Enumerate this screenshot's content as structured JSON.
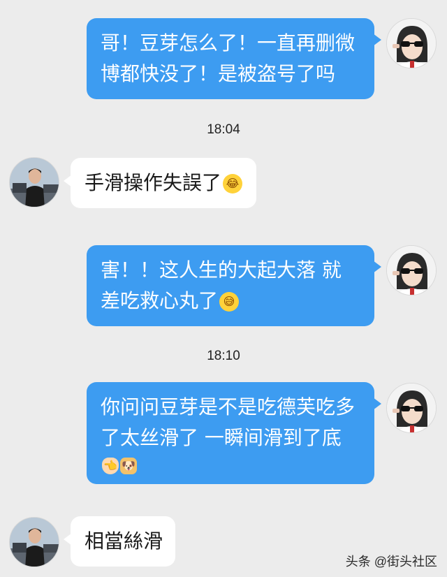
{
  "messages": [
    {
      "side": "me",
      "lines": [
        "哥！豆芽怎么了！一直再删微",
        "博都快没了！是被盗号了吗"
      ]
    },
    {
      "timestamp": "18:04"
    },
    {
      "side": "other",
      "lines": [
        "手滑操作失誤了"
      ],
      "emoji": "laughing-tears-emoji"
    },
    {
      "side": "me",
      "lines": [
        "害！！这人生的大起大落 就",
        "差吃救心丸了"
      ],
      "emoji": "grinning-sweat-emoji"
    },
    {
      "timestamp": "18:10"
    },
    {
      "side": "me",
      "lines": [
        "你问问豆芽是不是吃德芙吃多",
        "了太丝滑了 一瞬间滑到了底"
      ],
      "emoji": [
        "pointing-hand-emoji",
        "doge-emoji"
      ]
    },
    {
      "side": "other",
      "lines": [
        "相當絲滑"
      ]
    }
  ],
  "watermark": "头条 @街头社区",
  "colors": {
    "background": "#ececec",
    "my_bubble": "#3d9cf1",
    "other_bubble": "#ffffff"
  }
}
